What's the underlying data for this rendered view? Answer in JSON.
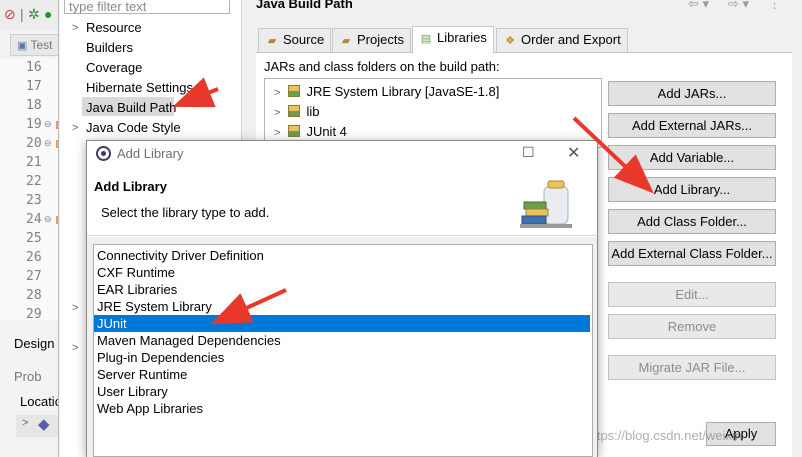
{
  "editor": {
    "tab_label": "Test",
    "line_numbers": [
      "16",
      "17",
      "18",
      "19",
      "20",
      "21",
      "22",
      "23",
      "24",
      "25",
      "26",
      "27",
      "28",
      "29"
    ],
    "design_tab": "Design",
    "problems_tab": "Prob",
    "location_label": "Locatio"
  },
  "properties": {
    "filter_placeholder": "type filter text",
    "categories": [
      {
        "label": "Resource",
        "expandable": true
      },
      {
        "label": "Builders",
        "expandable": false
      },
      {
        "label": "Coverage",
        "expandable": false
      },
      {
        "label": "Hibernate Settings",
        "expandable": false
      },
      {
        "label": "Java Build Path",
        "expandable": false,
        "selected": true
      },
      {
        "label": "Java Code Style",
        "expandable": true
      }
    ],
    "page_title": "Java Build Path",
    "tabs": [
      {
        "label": "Source",
        "icon": "source-folder-icon"
      },
      {
        "label": "Projects",
        "icon": "projects-folder-icon"
      },
      {
        "label": "Libraries",
        "icon": "libraries-icon",
        "active": true
      },
      {
        "label": "Order and Export",
        "icon": "order-export-icon"
      }
    ],
    "build_path_description": "JARs and class folders on the build path:",
    "libraries": [
      "JRE System Library [JavaSE-1.8]",
      "lib",
      "JUnit 4"
    ],
    "buttons": [
      {
        "label": "Add JARs...",
        "enabled": true
      },
      {
        "label": "Add External JARs...",
        "enabled": true
      },
      {
        "label": "Add Variable...",
        "enabled": true
      },
      {
        "label": "Add Library...",
        "enabled": true
      },
      {
        "label": "Add Class Folder...",
        "enabled": true
      },
      {
        "label": "Add External Class Folder...",
        "enabled": true
      },
      {
        "label": "Edit...",
        "enabled": false
      },
      {
        "label": "Remove",
        "enabled": false
      },
      {
        "label": "Migrate JAR File...",
        "enabled": false
      }
    ],
    "apply_label": "Apply",
    "watermark": "https://blog.csdn.net/weixin"
  },
  "add_library_dialog": {
    "window_title": "Add Library",
    "heading": "Add Library",
    "subheading": "Select the library type to add.",
    "library_types": [
      "Connectivity Driver Definition",
      "CXF Runtime",
      "EAR Libraries",
      "JRE System Library",
      "JUnit",
      "Maven Managed Dependencies",
      "Plug-in Dependencies",
      "Server Runtime",
      "User Library",
      "Web App Libraries"
    ],
    "selected_type": "JUnit"
  },
  "colors": {
    "selection": "#0078d7",
    "annotation_arrow": "#e8372b"
  }
}
